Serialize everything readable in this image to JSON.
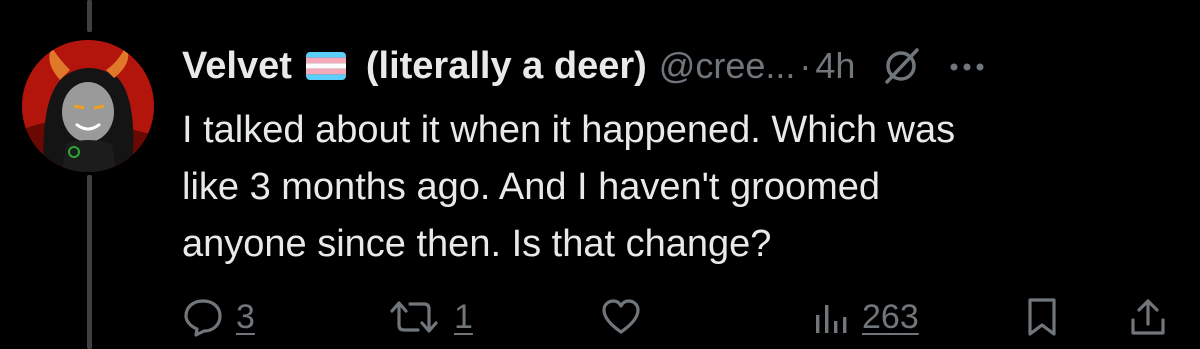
{
  "author": {
    "display_name": "Velvet",
    "flag_icon": "transgender-flag",
    "name_suffix": "(literally a deer)",
    "handle": "@cree...",
    "separator": "·",
    "time": "4h"
  },
  "tweet": {
    "lines": [
      "I talked about it when it happened. Which was",
      "like 3 months ago. And I haven't groomed",
      "anyone since then. Is that change?"
    ]
  },
  "actions": {
    "reply_count": "3",
    "retweet_count": "1",
    "views_count": "263"
  },
  "icons": {
    "reply": "speech-bubble-icon",
    "retweet": "retweet-arrows-icon",
    "like": "heart-outline-icon",
    "views": "bar-chart-icon",
    "bookmark": "bookmark-icon",
    "share": "share-upload-icon",
    "grok": "grok-slash-icon",
    "more": "ellipsis-icon"
  },
  "colors": {
    "background": "#000000",
    "text_primary": "#e7e9ea",
    "text_secondary": "#71767b",
    "thread_line": "#3e4144",
    "flag_blue": "#5bcefa",
    "flag_pink": "#f5a9b8",
    "flag_white": "#ffffff"
  }
}
